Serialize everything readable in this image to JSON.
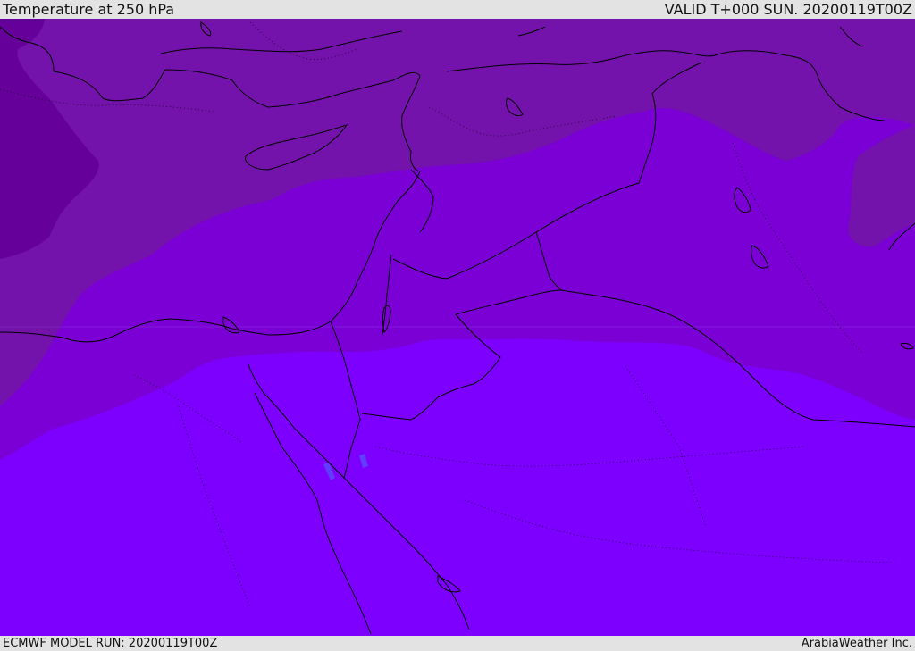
{
  "header": {
    "title": "Temperature at 250 hPa",
    "valid": "VALID T+000 SUN. 20200119T00Z"
  },
  "footer": {
    "model_run": "ECMWF MODEL RUN: 20200119T00Z",
    "credit": "ArabiaWeather Inc."
  },
  "map": {
    "field": "temperature",
    "level": "250 hPa",
    "colors": {
      "band_darkest": "#66009a",
      "band_dark": "#7412ac",
      "band_mid": "#7a00d6",
      "band_light": "#7b00f5",
      "band_lightest": "#7d00ff",
      "coastline": "#000000",
      "lake_highlight": "#5a4cff"
    }
  }
}
